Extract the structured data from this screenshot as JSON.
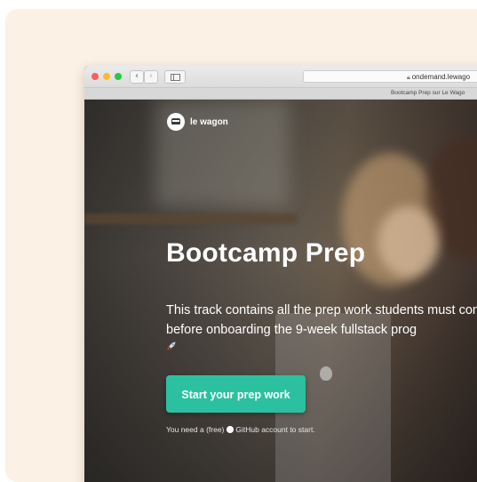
{
  "browser": {
    "url": "ondemand.lewago",
    "tab_title": "Bootcamp Prep sur Le Wago",
    "back_glyph": "‹",
    "forward_glyph": "›",
    "icons": [
      "close-dot",
      "minimize-dot",
      "zoom-dot",
      "back-arrow-icon",
      "forward-arrow-icon",
      "sidebar-icon",
      "lock-icon"
    ]
  },
  "page": {
    "logo_text": "le wagon",
    "title": "Bootcamp Prep",
    "description": "This track contains all the prep work students must complete before onboarding the 9-week fullstack prog",
    "cta_label": "Start your prep work",
    "hint_prefix": "You need a (free)",
    "hint_suffix": "GitHub account to start.",
    "icons": [
      "le-wagon-logo-icon",
      "rocket-icon",
      "github-icon"
    ]
  },
  "colors": {
    "card_background": "#fbf1e5",
    "cta_background": "#2bc1a0",
    "traffic_red": "#fc5f57",
    "traffic_yellow": "#fdbc2e",
    "traffic_green": "#28c840"
  }
}
